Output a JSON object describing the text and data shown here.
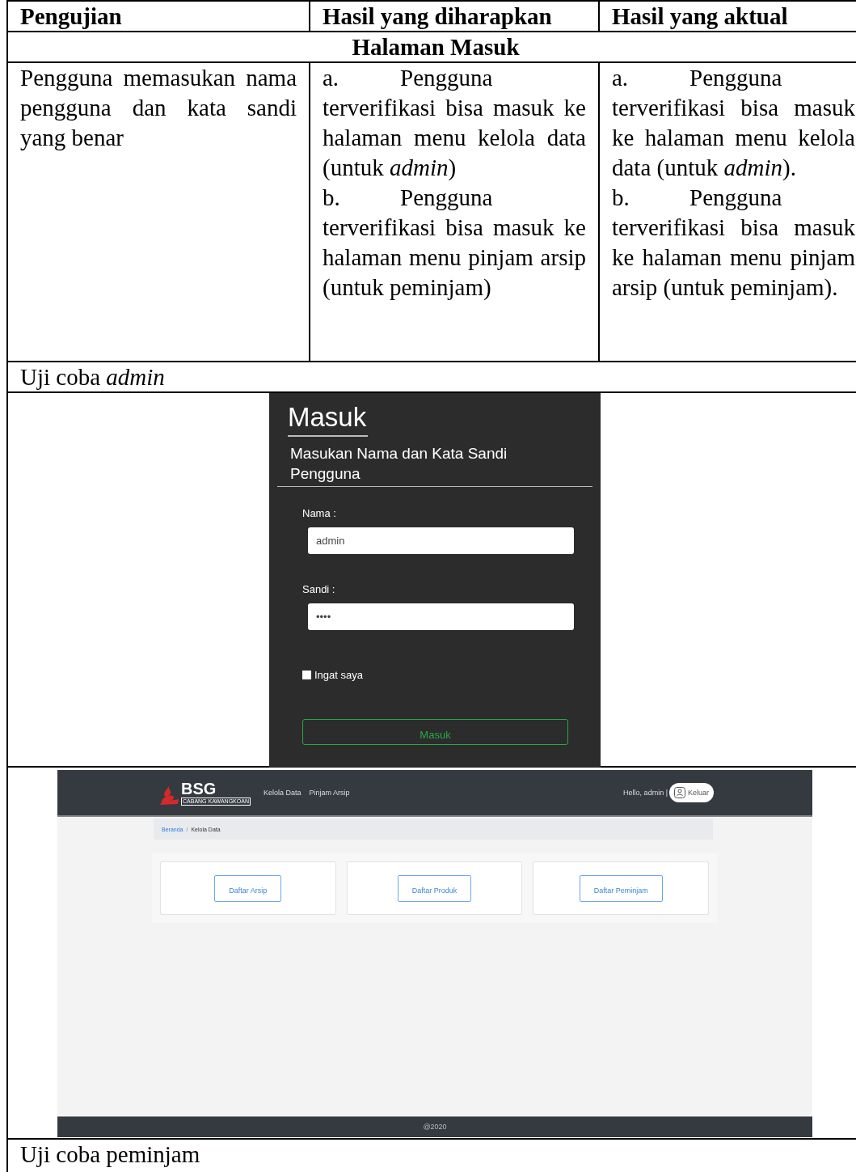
{
  "table": {
    "columns": [
      "Pengujian",
      "Hasil yang diharapkan",
      "Hasil yang aktual"
    ],
    "section_title": "Halaman Masuk",
    "rows": [
      {
        "test": "Pengguna memasukan nama pengguna dan kata sandi yang benar",
        "expected": [
          {
            "marker": "a.",
            "text": "Pengguna terverifikasi bisa masuk ke halaman menu kelola data (untuk *admin*)"
          },
          {
            "marker": "b.",
            "text": "Pengguna terverifikasi bisa masuk ke halaman menu pinjam arsip (untuk peminjam)"
          }
        ],
        "actual": [
          {
            "marker": "a.",
            "text": "Pengguna terverifikasi bisa masuk ke halaman menu kelola data (untuk *admin*)."
          },
          {
            "marker": "b.",
            "text": "Pengguna terverifikasi bisa masuk ke halaman menu pinjam arsip (untuk peminjam)."
          }
        ]
      }
    ]
  },
  "admin_trial_label": "Uji coba *admin*",
  "login_screen": {
    "title": "Masuk",
    "subtitle": "Masukan Nama dan Kata Sandi Pengguna",
    "fields": [
      {
        "label": "Nama :",
        "value": "admin"
      },
      {
        "label": "Sandi :",
        "value": "••••"
      }
    ],
    "remember": {
      "label": "Ingat saya",
      "checked": false
    },
    "submit": "Masuk"
  },
  "dashboard_screen": {
    "logo": {
      "name": "BSG",
      "branch": "CABANG KAWANGKOAN"
    },
    "nav": [
      {
        "label": "Kelola Data"
      },
      {
        "label": "Pinjam Arsip"
      }
    ],
    "greeting": "Hello, admin |",
    "logout": "Keluar",
    "breadcrumb": [
      {
        "label": "Beranda",
        "link": true
      },
      {
        "label": "Kelola Data",
        "link": false
      }
    ],
    "breadcrumb_separator": "/",
    "cards": [
      {
        "button": "Daftar Arsip"
      },
      {
        "button": "Daftar Produk"
      },
      {
        "button": "Daftar Peminjam"
      }
    ],
    "footer": "@2020"
  },
  "borrower_trial_label": "Uji coba peminjam"
}
